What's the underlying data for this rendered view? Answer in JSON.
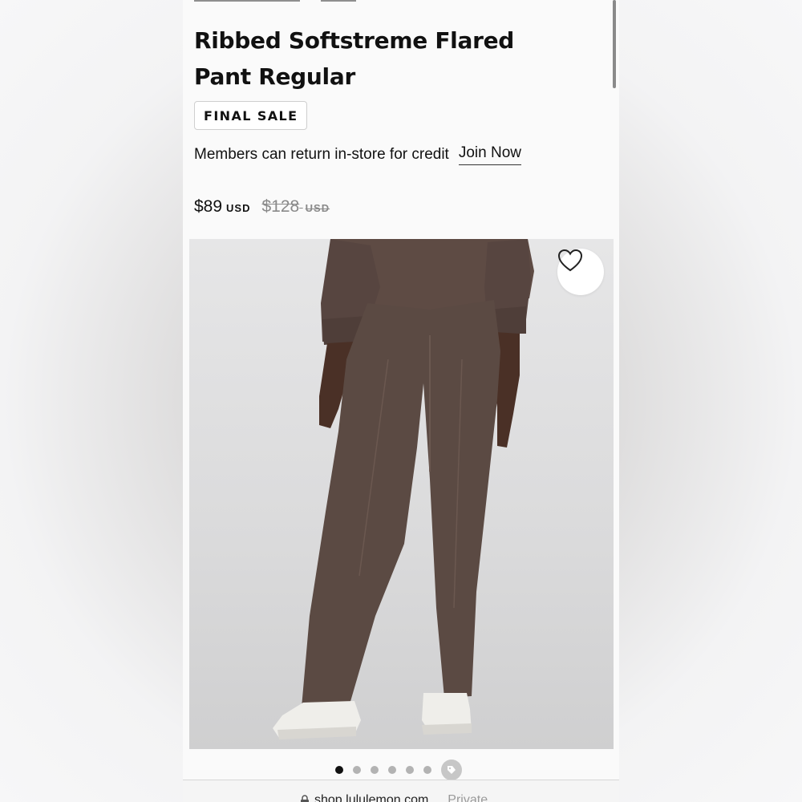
{
  "product": {
    "title": "Ribbed Softstreme Flared Pant Regular",
    "badge": "FINAL SALE",
    "member_text": "Members can return in-store for credit",
    "join_label": "Join Now",
    "price": "$89",
    "currency": "USD",
    "original_price": "$128",
    "original_currency": "USD"
  },
  "gallery": {
    "total_dots": 6,
    "active_dot": 1,
    "wishlist_icon": "heart-outline-icon",
    "extra_icon": "tag-icon"
  },
  "browser": {
    "url": "shop.lululemon.com",
    "mode": "Private"
  },
  "colors": {
    "pant": "#5b4a43",
    "sweatshirt": "#5e4b44",
    "background": "#fafafa"
  }
}
